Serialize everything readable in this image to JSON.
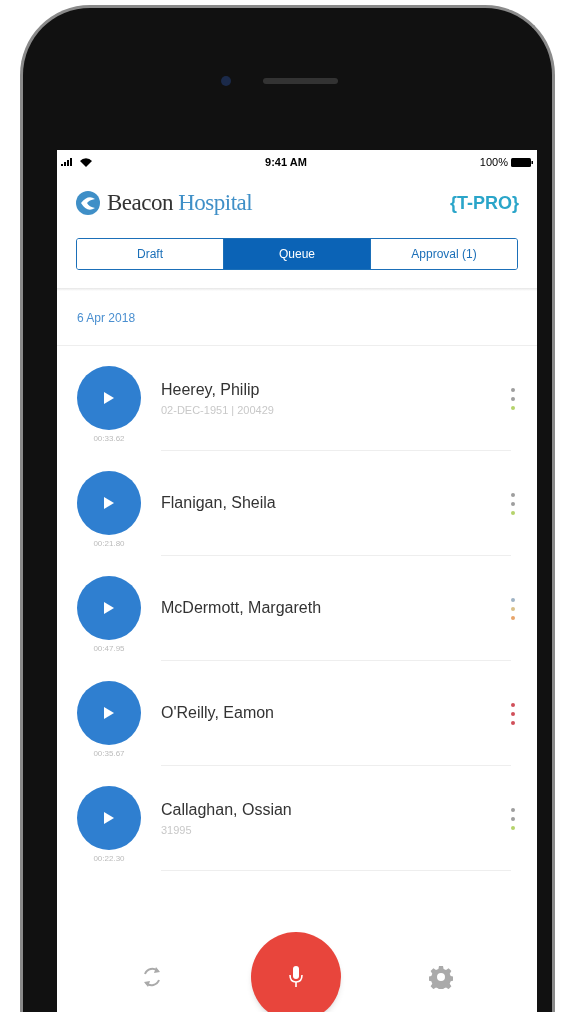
{
  "status_bar": {
    "time": "9:41 AM",
    "battery": "100%"
  },
  "header": {
    "brand_dark": "Beacon",
    "brand_light": "Hospital",
    "badge": "{T-PRO}"
  },
  "tabs": [
    {
      "label": "Draft",
      "selected": false
    },
    {
      "label": "Queue",
      "selected": true
    },
    {
      "label": "Approval (1)",
      "selected": false
    }
  ],
  "date": "6 Apr 2018",
  "recordings": [
    {
      "duration": "00:33.62",
      "name": "Heerey, Philip",
      "details": "02-DEC-1951 | 200429",
      "dots": [
        {
          "color": "#9e9e9e"
        },
        {
          "color": "#9e9e9e"
        },
        {
          "color": "#b5d36b"
        }
      ]
    },
    {
      "duration": "00:21.80",
      "name": "Flanigan, Sheila",
      "dots": [
        {
          "color": "#9e9e9e"
        },
        {
          "color": "#9e9e9e"
        },
        {
          "color": "#b5d36b"
        }
      ]
    },
    {
      "duration": "00:47.95",
      "name": "McDermott, Margareth",
      "dots": [
        {
          "color": "#9fb3c4"
        },
        {
          "color": "#d8c08a"
        },
        {
          "color": "#e8a46a"
        }
      ]
    },
    {
      "duration": "00:35.67",
      "name": "O'Reilly, Eamon",
      "dots": [
        {
          "color": "#d0505a"
        },
        {
          "color": "#d0505a"
        },
        {
          "color": "#d0505a"
        }
      ]
    },
    {
      "duration": "00:22.30",
      "name": "Callaghan, Ossian",
      "details": "31995",
      "dots": [
        {
          "color": "#9e9e9e"
        },
        {
          "color": "#9e9e9e"
        },
        {
          "color": "#b5d36b"
        }
      ]
    }
  ]
}
